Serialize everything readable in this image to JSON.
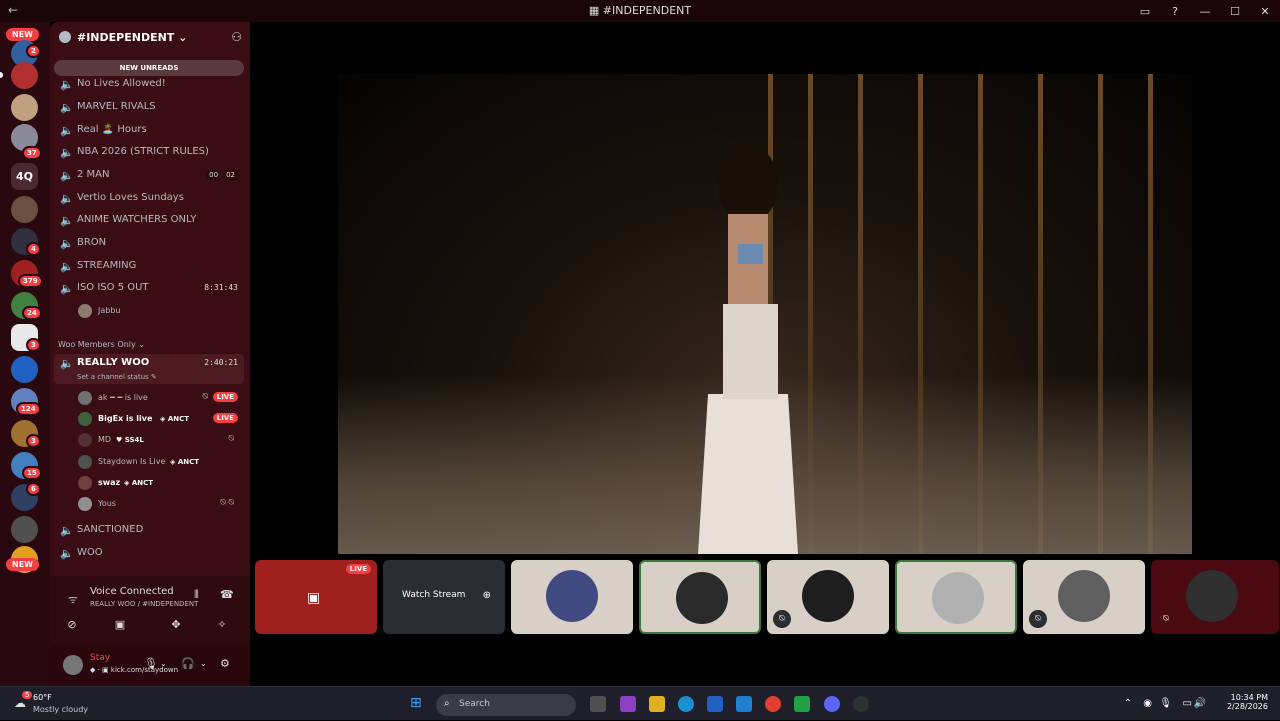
{
  "window": {
    "title": "#INDEPENDENT",
    "back": "←",
    "forward": "→",
    "controls": [
      "▭",
      "?",
      "—",
      "☐",
      "✕"
    ]
  },
  "guilds": {
    "new_top": "NEW",
    "new_bottom": "NEW",
    "label_4q": "4Q",
    "badges": [
      "2",
      "37",
      "4",
      "379",
      "24",
      "3",
      "124",
      "3",
      "15",
      "6"
    ]
  },
  "server": {
    "name": "#INDEPENDENT",
    "chevron": "⌄",
    "invite_icon": "person-add-icon",
    "new_unreads": "NEW UNREADS"
  },
  "channels": [
    {
      "label": "No Lives Allowed!"
    },
    {
      "label": "MARVEL RIVALS"
    },
    {
      "label": "Real 🏝️ Hours"
    },
    {
      "label": "NBA 2026 (STRICT RULES)"
    },
    {
      "label": "2 MAN",
      "counters": [
        "00",
        "02"
      ]
    },
    {
      "label": "Vertio Loves Sundays"
    },
    {
      "label": "ANIME WATCHERS ONLY"
    },
    {
      "label": "BRON"
    },
    {
      "label": "STREAMING"
    },
    {
      "label": "ISO ISO 5 OUT",
      "timer": "8:31:43"
    }
  ],
  "iso_user": "Jabbu",
  "category": "Woo Members Only",
  "active_channel": {
    "label": "REALLY WOO",
    "timer": "2:40:21",
    "status": "Set a channel status ✎"
  },
  "voice_users": [
    {
      "name": "ak ━ ━ is live",
      "live": "LIVE"
    },
    {
      "name": "BigEx is live",
      "tag": "ANCT",
      "live": "LIVE"
    },
    {
      "name": "MD",
      "tag": "SS4L"
    },
    {
      "name": "Staydown Is Live",
      "tag": "ANCT"
    },
    {
      "name": "swaz",
      "tag": "ANCT"
    },
    {
      "name": "Yous"
    }
  ],
  "after_channels": [
    {
      "label": "SANCTIONED"
    },
    {
      "label": "WOO"
    }
  ],
  "voice_panel": {
    "title": "Voice Connected",
    "subtitle": "REALLY WOO / #INDEPENDENT"
  },
  "user_panel": {
    "name": "Stay",
    "status": "kick.com/staydown"
  },
  "tiles": {
    "live": "LIVE",
    "watch_stream": "Watch Stream"
  },
  "taskbar": {
    "temp": "60°F",
    "weather": "Mostly cloudy",
    "weather_badge": "5",
    "search": "Search",
    "time": "10:34 PM",
    "date": "2/28/2026"
  },
  "colors": {
    "accent_red": "#f23f43",
    "live_green": "#23a55a",
    "sidebar": "#3a0d14"
  }
}
